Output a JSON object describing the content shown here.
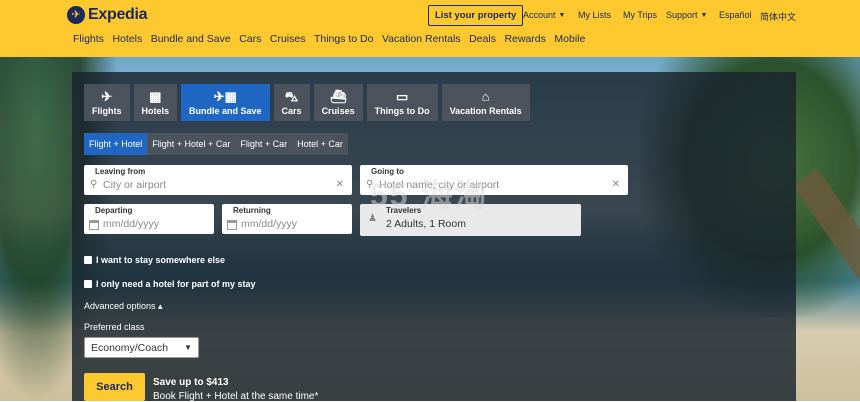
{
  "header": {
    "brand": "Expedia",
    "list_property": "List your property",
    "util": {
      "account": "Account",
      "my_lists": "My Lists",
      "my_trips": "My Trips",
      "support": "Support",
      "espanol": "Español",
      "chinese": "简体中文"
    },
    "nav": [
      "Flights",
      "Hotels",
      "Bundle and Save",
      "Cars",
      "Cruises",
      "Things to Do",
      "Vacation Rentals",
      "Deals",
      "Rewards",
      "Mobile"
    ]
  },
  "search": {
    "tabs": [
      {
        "label": "Flights",
        "icon": "plane-icon"
      },
      {
        "label": "Hotels",
        "icon": "building-icon"
      },
      {
        "label": "Bundle and Save",
        "icon": "bundle-icon"
      },
      {
        "label": "Cars",
        "icon": "car-icon"
      },
      {
        "label": "Cruises",
        "icon": "ship-icon"
      },
      {
        "label": "Things to Do",
        "icon": "ticket-icon"
      },
      {
        "label": "Vacation Rentals",
        "icon": "house-icon"
      }
    ],
    "subtabs": [
      "Flight + Hotel",
      "Flight + Hotel + Car",
      "Flight + Car",
      "Hotel + Car"
    ],
    "leaving_from": {
      "label": "Leaving from",
      "placeholder": "City or airport"
    },
    "going_to": {
      "label": "Going to",
      "placeholder": "Hotel name, city or airport"
    },
    "departing": {
      "label": "Departing",
      "placeholder": "mm/dd/yyyy"
    },
    "returning": {
      "label": "Returning",
      "placeholder": "mm/dd/yyyy"
    },
    "travelers": {
      "label": "Travelers",
      "value": "2 Adults, 1 Room"
    },
    "check_stay_elsewhere": "I want to stay somewhere else",
    "check_hotel_part": "I only need a hotel for part of my stay",
    "advanced_options": "Advanced options ▴",
    "preferred_class_label": "Preferred class",
    "preferred_class_value": "Economy/Coach",
    "search_button": "Search",
    "promo_title": "Save up to $413",
    "promo_sub": "Book Flight + Hotel at the same time*"
  },
  "watermark": "55 海淘"
}
